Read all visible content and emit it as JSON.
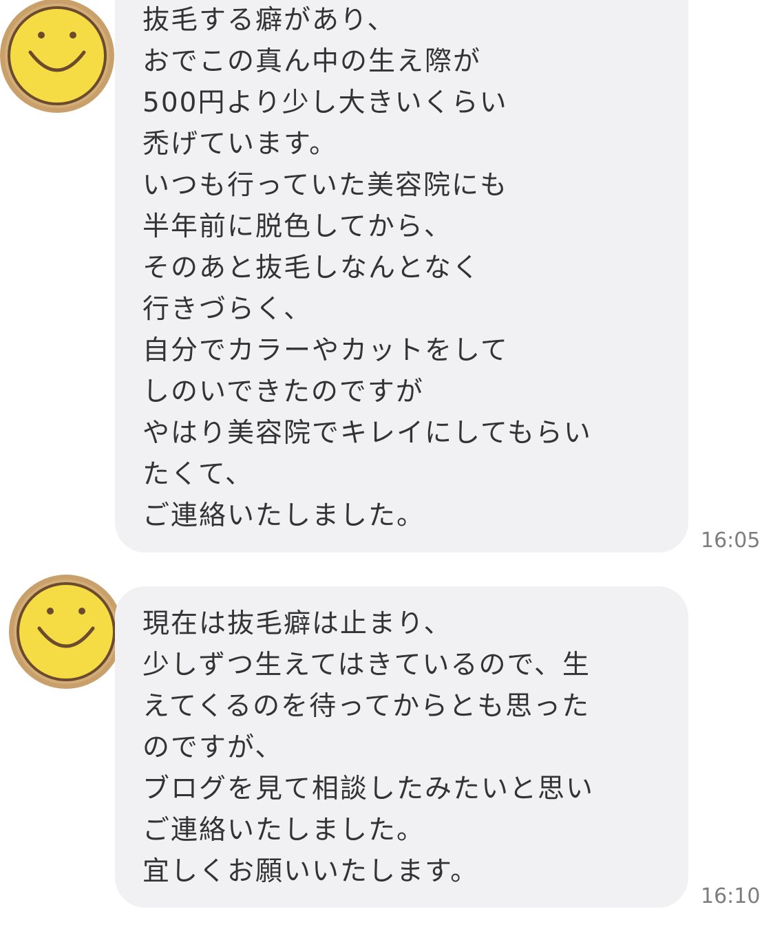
{
  "messages": [
    {
      "avatar_icon": "smiley-face-icon",
      "lines": [
        "抜毛する癖があり、",
        "おでこの真ん中の生え際が",
        "500円より少し大きいくらい",
        "禿げています。",
        "いつも行っていた美容院にも",
        "半年前に脱色してから、",
        "そのあと抜毛しなんとなく",
        "行きづらく、",
        "自分でカラーやカットをして",
        "しのいできたのですが",
        "やはり美容院でキレイにしてもらい",
        "たくて、",
        "ご連絡いたしました。"
      ],
      "time": "16:05"
    },
    {
      "avatar_icon": "smiley-face-icon",
      "lines": [
        "現在は抜毛癖は止まり、",
        "少しずつ生えてはきているので、生",
        "えてくるのを待ってからとも思った",
        "のですが、",
        "ブログを見て相談したみたいと思い",
        "ご連絡いたしました。",
        "宜しくお願いいたします。"
      ],
      "time": "16:10"
    }
  ],
  "colors": {
    "bubble": "#f1f1f3",
    "text": "#333333",
    "time": "#7d7d7d",
    "avatar_ring": "#c9a06a",
    "avatar_face": "#f5dc45",
    "avatar_outline": "#6b4a2e"
  }
}
